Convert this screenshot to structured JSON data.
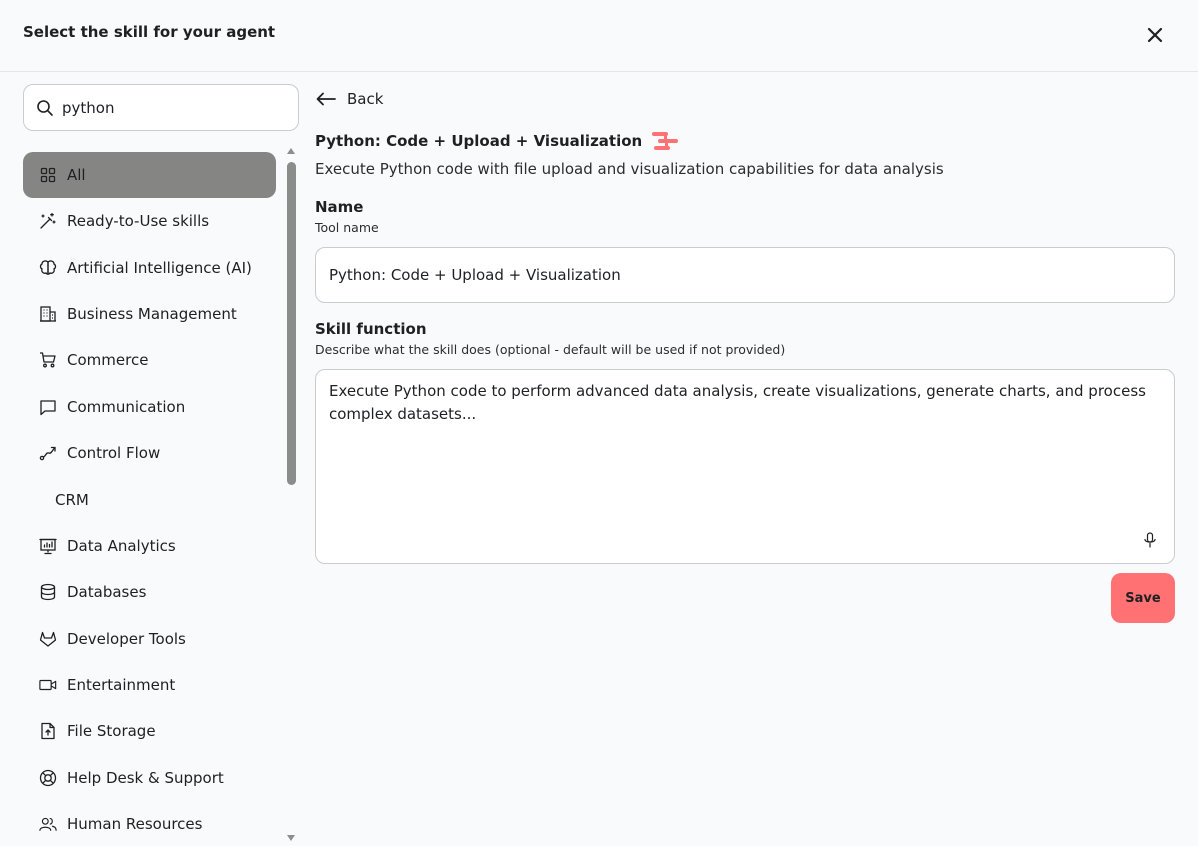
{
  "header": {
    "title": "Select the skill for your agent",
    "close_icon": "close-icon"
  },
  "search": {
    "value": "python",
    "placeholder": "Search skills",
    "icon": "search-icon"
  },
  "categories": [
    {
      "label": "All",
      "icon": "grid-icon",
      "active": true
    },
    {
      "label": "Ready-to-Use skills",
      "icon": "magic-wand-icon"
    },
    {
      "label": "Artificial Intelligence (AI)",
      "icon": "brain-icon"
    },
    {
      "label": "Business Management",
      "icon": "building-icon"
    },
    {
      "label": "Commerce",
      "icon": "cart-icon"
    },
    {
      "label": "Communication",
      "icon": "chat-icon"
    },
    {
      "label": "Control Flow",
      "icon": "flow-icon"
    },
    {
      "label": "CRM",
      "icon": ""
    },
    {
      "label": "Data Analytics",
      "icon": "chart-board-icon"
    },
    {
      "label": "Databases",
      "icon": "database-icon"
    },
    {
      "label": "Developer Tools",
      "icon": "gitlab-icon"
    },
    {
      "label": "Entertainment",
      "icon": "video-icon"
    },
    {
      "label": "File Storage",
      "icon": "file-upload-icon"
    },
    {
      "label": "Help Desk & Support",
      "icon": "lifebuoy-icon"
    },
    {
      "label": "Human Resources",
      "icon": "people-icon"
    }
  ],
  "main": {
    "back_label": "Back",
    "skill_title": "Python: Code + Upload + Visualization",
    "skill_description": "Execute Python code with file upload and visualization capabilities for data analysis",
    "name_label": "Name",
    "name_hint": "Tool name",
    "name_value": "Python: Code + Upload + Visualization",
    "function_label": "Skill function",
    "function_hint": "Describe what the skill does (optional - default will be used if not provided)",
    "function_value": "Execute Python code to perform advanced data analysis, create visualizations, generate charts, and process complex datasets...",
    "save_label": "Save"
  },
  "colors": {
    "accent": "#ff7172",
    "active_category": "#858683",
    "background": "#f8fafc"
  }
}
